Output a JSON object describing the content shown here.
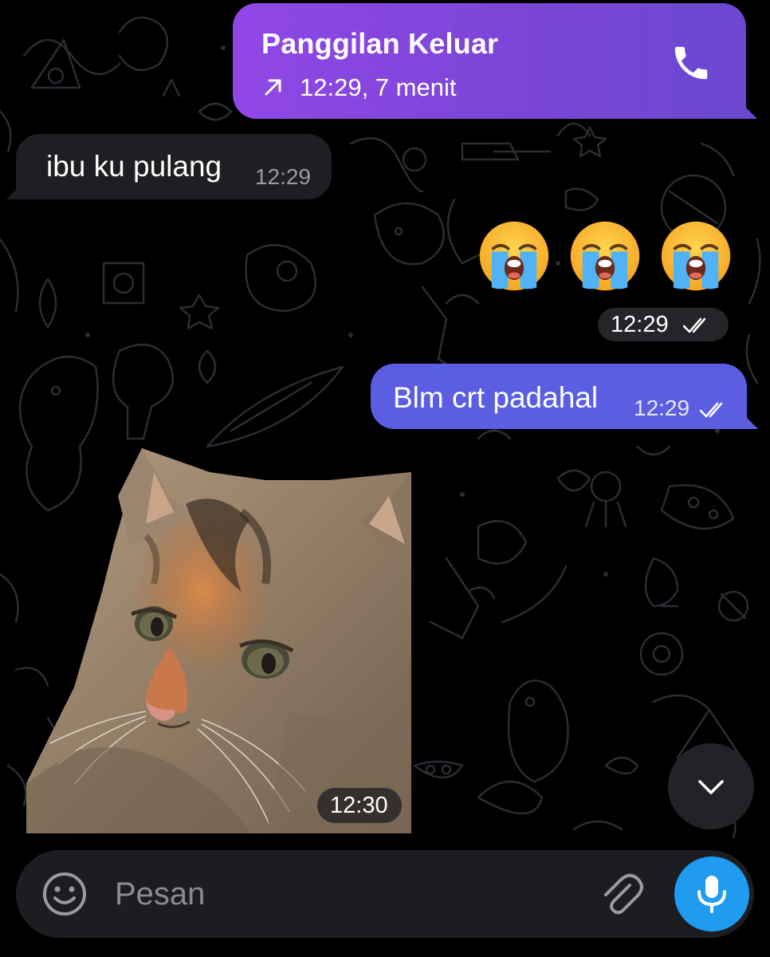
{
  "call": {
    "title": "Panggilan Keluar",
    "meta": "12:29, 7 menit",
    "direction_icon": "arrow-up-right-icon",
    "action_icon": "phone-icon"
  },
  "incoming": {
    "text": "ibu ku pulang",
    "time": "12:29"
  },
  "emoji_message": {
    "emojis": [
      "loudly-crying-face",
      "loudly-crying-face",
      "loudly-crying-face"
    ],
    "time": "12:29",
    "status_icon": "double-check-icon"
  },
  "outgoing": {
    "text": "Blm crt padahal",
    "time": "12:29",
    "status_icon": "double-check-icon"
  },
  "sticker": {
    "subject": "sad-cat-sticker",
    "time": "12:30"
  },
  "composer": {
    "placeholder": "Pesan",
    "value": ""
  },
  "colors": {
    "background": "#000000",
    "call_bubble": "#8746e0",
    "outgoing_bubble": "#5b5ee0",
    "incoming_bubble": "#1e1f22",
    "mic_button": "#1f9bf0"
  }
}
